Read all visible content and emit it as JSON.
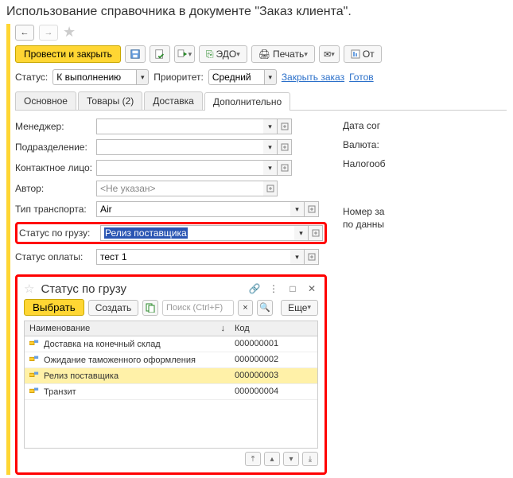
{
  "title": "Использование справочника в документе \"Заказ клиента\".",
  "toolbar": {
    "post_close": "Провести и закрыть",
    "edo": "ЭДО",
    "print": "Печать",
    "reports": "От"
  },
  "statusbar": {
    "status_label": "Статус:",
    "status_value": "К выполнению",
    "priority_label": "Приоритет:",
    "priority_value": "Средний",
    "close_order": "Закрыть заказ",
    "ready": "Готов"
  },
  "tabs": [
    "Основное",
    "Товары (2)",
    "Доставка",
    "Дополнительно"
  ],
  "active_tab": 3,
  "fields": {
    "manager_label": "Менеджер:",
    "department_label": "Подразделение:",
    "contact_label": "Контактное лицо:",
    "author_label": "Автор:",
    "author_value": "<Не указан>",
    "transport_label": "Тип транспорта:",
    "transport_value": "Air",
    "cargo_status_label": "Статус по грузу:",
    "cargo_status_value": "Релиз поставщика",
    "payment_status_label": "Статус оплаты:",
    "payment_status_value": "тест 1"
  },
  "right_column": {
    "date_agree": "Дата сог",
    "currency": "Валюта:",
    "tax": "Налогооб",
    "order_no": "Номер за",
    "by_data": "по данны"
  },
  "popup": {
    "title": "Статус по грузу",
    "select": "Выбрать",
    "create": "Создать",
    "search_placeholder": "Поиск (Ctrl+F)",
    "more": "Еще",
    "col_name": "Наименование",
    "col_code": "Код",
    "rows": [
      {
        "name": "Доставка на конечный склад",
        "code": "000000001",
        "selected": false
      },
      {
        "name": "Ожидание таможенного оформления",
        "code": "000000002",
        "selected": false
      },
      {
        "name": "Релиз поставщика",
        "code": "000000003",
        "selected": true
      },
      {
        "name": "Транзит",
        "code": "000000004",
        "selected": false
      }
    ]
  }
}
